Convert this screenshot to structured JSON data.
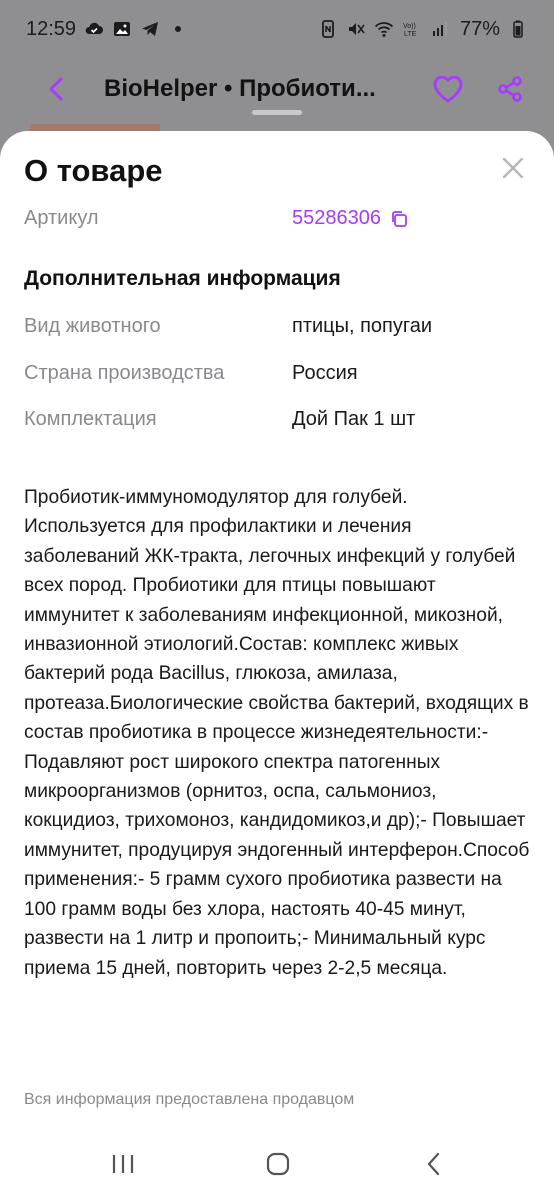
{
  "status_bar": {
    "time": "12:59",
    "battery": "77%",
    "icons_left": [
      "cloud-check-icon",
      "image-icon",
      "telegram-icon",
      "dot-icon"
    ],
    "icons_right": [
      "nfc-icon",
      "mute-icon",
      "wifi-icon",
      "volte-icon",
      "signal-icon",
      "battery-icon"
    ]
  },
  "header": {
    "title": "BioHelper • Пробиоти...",
    "back_icon": "chevron-left-icon",
    "favorite_icon": "heart-icon",
    "share_icon": "share-icon",
    "accent_color": "#a73afd"
  },
  "sheet": {
    "title": "О товаре",
    "article": {
      "label": "Артикул",
      "value": "55286306"
    },
    "section_title": "Дополнительная информация",
    "attributes": [
      {
        "label": "Вид животного",
        "value": "птицы, попугаи"
      },
      {
        "label": "Страна производства",
        "value": "Россия"
      },
      {
        "label": "Комплектация",
        "value": "Дой Пак 1 шт"
      }
    ],
    "description": "Пробиотик-иммуномодулятор для голубей. Используется для профилактики и лечения заболеваний ЖК-тракта, легочных инфекций у голубей всех пород. Пробиотики для птицы повышают иммунитет к заболеваниям инфекционной, микозной, инвазионной этиологий.Состав: комплекс живых бактерий рода Bacillus, глюкоза, амилаза, протеаза.Биологические свойства бактерий, входящих в состав пробиотика в процессе жизнедеятельности:- Подавляют рост широкого спектра патогенных микроорганизмов (орнитоз, оспа, сальмониоз, кокцидиоз, трихомоноз, кандидомикоз,и др);- Повышает иммунитет, продуцируя эндогенный интерферон.Способ применения:- 5 грамм сухого пробиотика развести на 100 грамм воды без хлора, настоять 40-45 минут, развести на 1 литр и пропоить;- Минимальный курс приема 15 дней, повторить через 2-2,5 месяца.",
    "disclaimer": "Вся информация предоставлена продавцом"
  },
  "nav_bar": {
    "buttons": [
      "recents-icon",
      "home-icon",
      "back-icon"
    ]
  }
}
